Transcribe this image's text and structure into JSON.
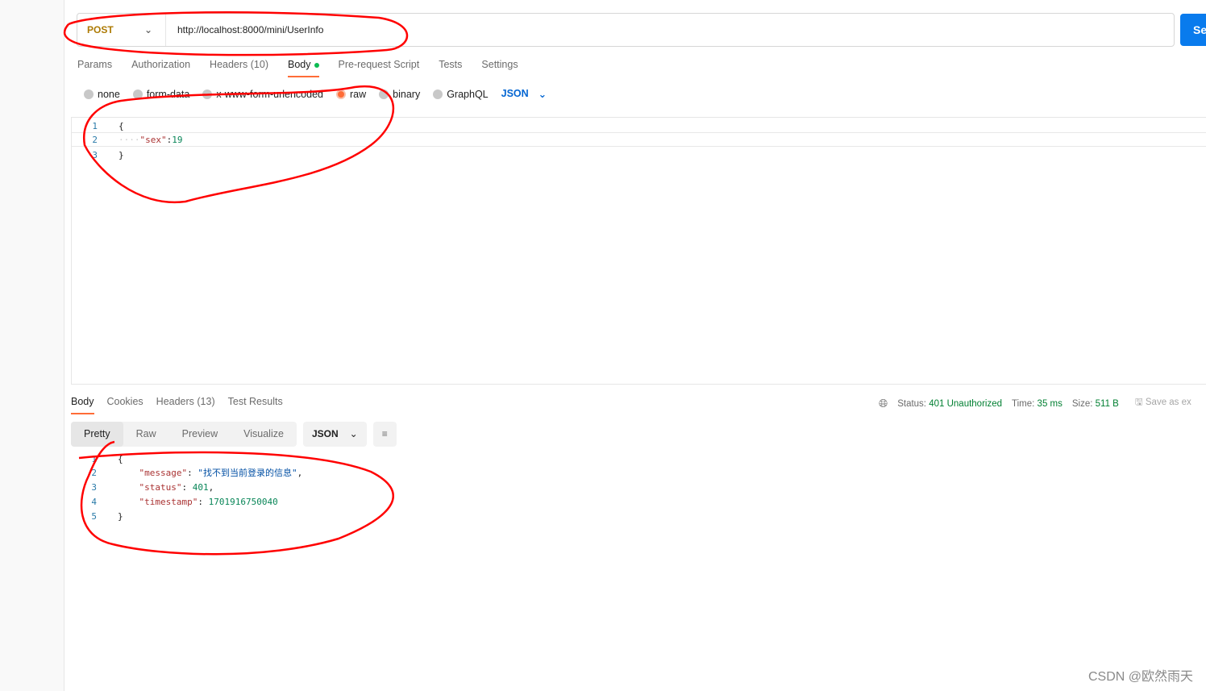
{
  "request": {
    "method": "POST",
    "url": "http://localhost:8000/mini/UserInfo",
    "send_label": "Se"
  },
  "tabs": [
    "Params",
    "Authorization",
    "Headers (10)",
    "Body",
    "Pre-request Script",
    "Tests",
    "Settings"
  ],
  "body_types": [
    "none",
    "form-data",
    "x-www-form-urlencoded",
    "raw",
    "binary",
    "GraphQL"
  ],
  "body_format": "JSON",
  "request_body": {
    "lines": [
      "1",
      "2",
      "3"
    ],
    "open": "{",
    "key": "\"sex\"",
    "value": "19",
    "close": "}"
  },
  "response_tabs": [
    "Body",
    "Cookies",
    "Headers (13)",
    "Test Results"
  ],
  "status": {
    "status_label": "Status:",
    "status_value": "401 Unauthorized",
    "time_label": "Time:",
    "time_value": "35 ms",
    "size_label": "Size:",
    "size_value": "511 B",
    "save_label": "Save as ex"
  },
  "view_modes": [
    "Pretty",
    "Raw",
    "Preview",
    "Visualize"
  ],
  "response_format": "JSON",
  "response_body": {
    "lines": [
      "1",
      "2",
      "3",
      "4",
      "5"
    ],
    "open": "{",
    "message_key": "\"message\"",
    "message_value": "\"找不到当前登录的信息\"",
    "status_key": "\"status\"",
    "status_value": "401",
    "timestamp_key": "\"timestamp\"",
    "timestamp_value": "1701916750040",
    "close": "}"
  },
  "watermark": "CSDN @欧然雨天",
  "colors": {
    "accent": "#ff6c37",
    "send": "#097bed",
    "annotation": "#ff0000",
    "status_ok_text": "#007f31"
  }
}
